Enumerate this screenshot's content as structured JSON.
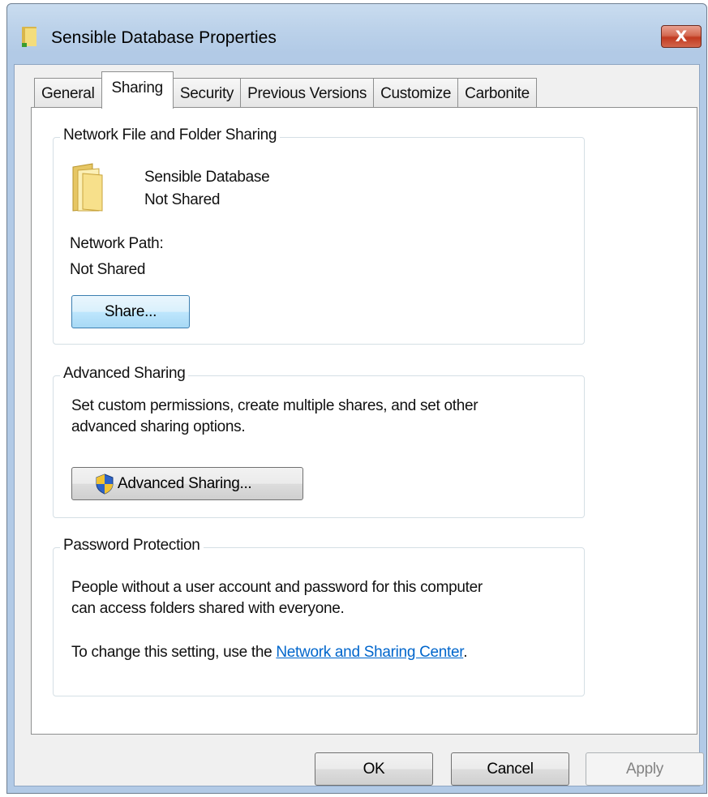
{
  "window": {
    "title": "Sensible Database Properties",
    "close_label": "X"
  },
  "tabs": [
    {
      "label": "General"
    },
    {
      "label": "Sharing",
      "active": true
    },
    {
      "label": "Security"
    },
    {
      "label": "Previous Versions"
    },
    {
      "label": "Customize"
    },
    {
      "label": "Carbonite"
    }
  ],
  "network_sharing": {
    "group_title": "Network File and Folder Sharing",
    "folder_name": "Sensible Database",
    "folder_status": "Not Shared",
    "path_label": "Network Path:",
    "path_value": "Not Shared",
    "share_button": "Share..."
  },
  "advanced_sharing": {
    "group_title": "Advanced Sharing",
    "description_line1": "Set custom permissions, create multiple shares, and set other",
    "description_line2": "advanced sharing options.",
    "button": "Advanced Sharing..."
  },
  "password_protection": {
    "group_title": "Password Protection",
    "description_line1": "People without a user account and password for this computer",
    "description_line2": "can access folders shared with everyone.",
    "change_prefix": "To change this setting, use the ",
    "link": "Network and Sharing Center",
    "change_suffix": "."
  },
  "footer": {
    "ok": "OK",
    "cancel": "Cancel",
    "apply": "Apply"
  },
  "icons": {
    "title_icon": "folder-icon",
    "folder_icon": "folder-icon",
    "shield_icon": "uac-shield-icon"
  }
}
